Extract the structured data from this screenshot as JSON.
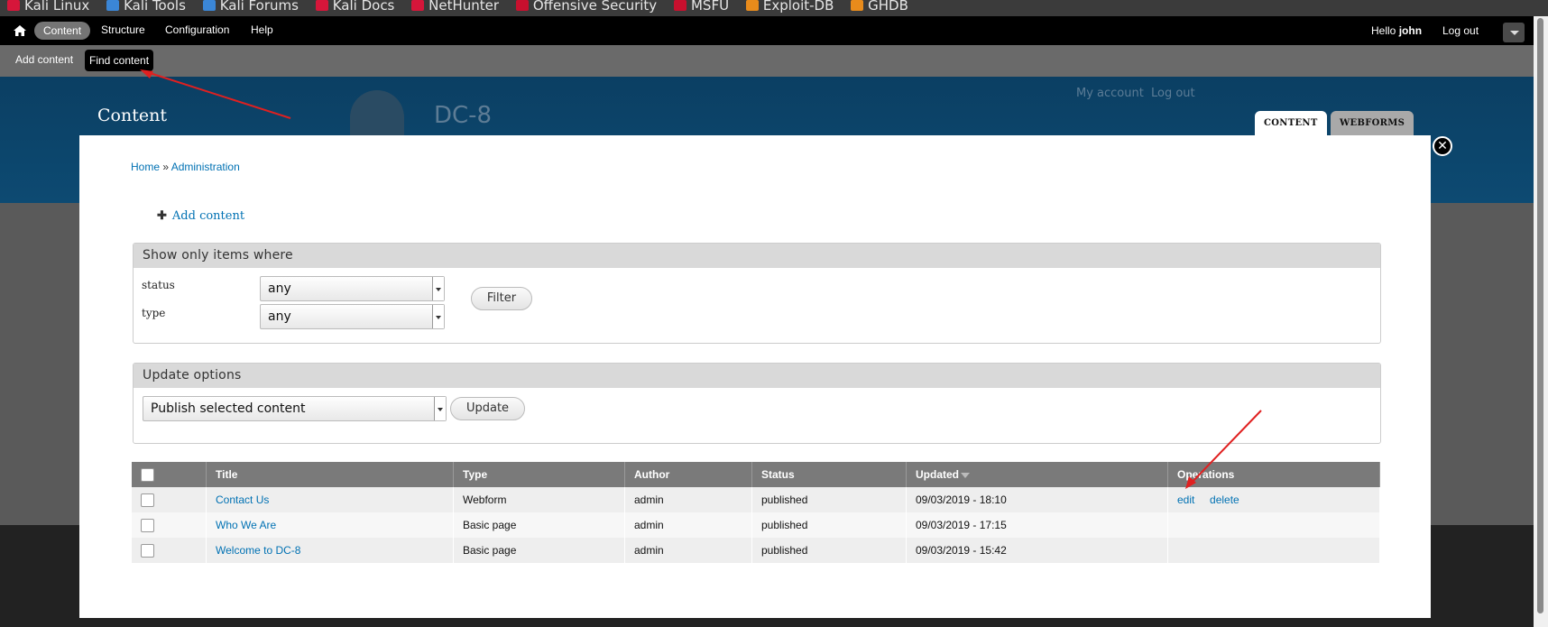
{
  "bookmarks": [
    {
      "label": "Kali Linux",
      "color": "#d6163a"
    },
    {
      "label": "Kali Tools",
      "color": "#3b86d6"
    },
    {
      "label": "Kali Forums",
      "color": "#3b86d6"
    },
    {
      "label": "Kali Docs",
      "color": "#d6163a"
    },
    {
      "label": "NetHunter",
      "color": "#d6163a"
    },
    {
      "label": "Offensive Security",
      "color": "#c8102e"
    },
    {
      "label": "MSFU",
      "color": "#c8102e"
    },
    {
      "label": "Exploit-DB",
      "color": "#e88b1b"
    },
    {
      "label": "GHDB",
      "color": "#e88b1b"
    }
  ],
  "toolbar": {
    "items": [
      "Content",
      "Structure",
      "Configuration",
      "Help"
    ],
    "hello_prefix": "Hello",
    "user": "john",
    "logout": "Log out"
  },
  "shortcuts": {
    "add_content": "Add content",
    "find_content": "Find content"
  },
  "site": {
    "page_title": "Content",
    "name": "DC-8",
    "my_account": "My account",
    "log_out": "Log out",
    "tabs": [
      "CONTENT",
      "WEBFORMS"
    ]
  },
  "overlay": {
    "close_symbol": "✕",
    "breadcrumb": {
      "home": "Home",
      "sep": "»",
      "admin": "Administration"
    },
    "add_content": "Add content",
    "filter": {
      "legend": "Show only items where",
      "status_label": "status",
      "status_value": "any",
      "type_label": "type",
      "type_value": "any",
      "button": "Filter"
    },
    "update": {
      "legend": "Update options",
      "select_value": "Publish selected content",
      "button": "Update"
    },
    "table": {
      "headers": [
        "Title",
        "Type",
        "Author",
        "Status",
        "Updated",
        "Operations"
      ],
      "rows": [
        {
          "title": "Contact Us",
          "type": "Webform",
          "author": "admin",
          "status": "published",
          "updated": "09/03/2019 - 18:10",
          "op_edit": "edit",
          "op_delete": "delete"
        },
        {
          "title": "Who We Are",
          "type": "Basic page",
          "author": "admin",
          "status": "published",
          "updated": "09/03/2019 - 17:15",
          "op_edit": "",
          "op_delete": ""
        },
        {
          "title": "Welcome to DC-8",
          "type": "Basic page",
          "author": "admin",
          "status": "published",
          "updated": "09/03/2019 - 15:42",
          "op_edit": "",
          "op_delete": ""
        }
      ]
    }
  },
  "colors": {
    "link": "#0071b3",
    "annotation": "#e02020"
  }
}
